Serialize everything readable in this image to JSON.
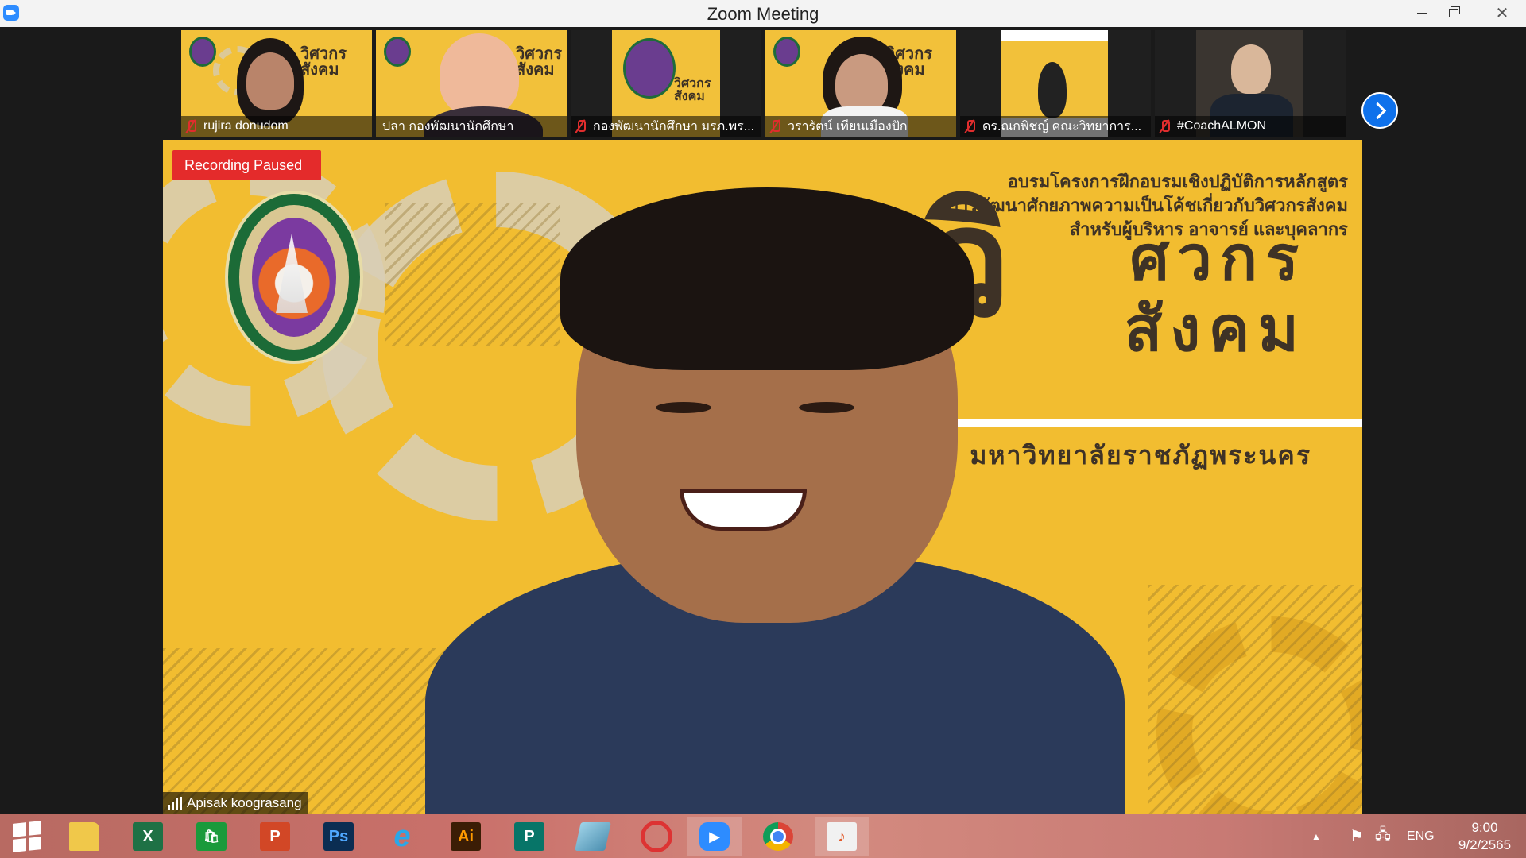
{
  "window": {
    "title": "Zoom Meeting"
  },
  "participants": [
    {
      "name": "rujira donudom",
      "muted": true
    },
    {
      "name": "ปลา กองพัฒนานักศึกษา",
      "muted": false
    },
    {
      "name": "กองพัฒนานักศึกษา มรภ.พร...",
      "muted": true
    },
    {
      "name": "วรารัตน์ เทียนเมืองปัก",
      "muted": true
    },
    {
      "name": "ดร.ณกพิชญ์ คณะวิทยาการ...",
      "muted": true
    },
    {
      "name": "#CoachALMON",
      "muted": true
    }
  ],
  "main": {
    "recording_status": "Recording Paused",
    "speaker_name": "Apisak koograsang",
    "banner": {
      "line1": "อบรมโครงการฝึกอบรมเชิงปฏิบัติการหลักสูตร",
      "line2": "การพัฒนาศักยภาพความเป็นโค้ชเกี่ยวกับวิศวกรสังคม",
      "line3": "สำหรับผู้บริหาร อาจารย์ และบุคลากร",
      "brand_letter": "วิ",
      "brand_line1": "ศวกร",
      "brand_line2": "สังคม",
      "university": "มหาวิทยาลัยราชภัฏพระนคร"
    }
  },
  "taskbar": {
    "apps": [
      "start",
      "file-explorer",
      "excel",
      "store",
      "powerpoint",
      "photoshop",
      "internet-explorer",
      "illustrator",
      "publisher",
      "notes",
      "photoscape",
      "zoom",
      "chrome",
      "photos"
    ],
    "labels": {
      "excel": "X",
      "powerpoint": "P",
      "photoshop": "Ps",
      "illustrator": "Ai",
      "publisher": "P",
      "photos": "♪"
    },
    "language": "ENG",
    "time": "9:00",
    "date": "9/2/2565"
  }
}
